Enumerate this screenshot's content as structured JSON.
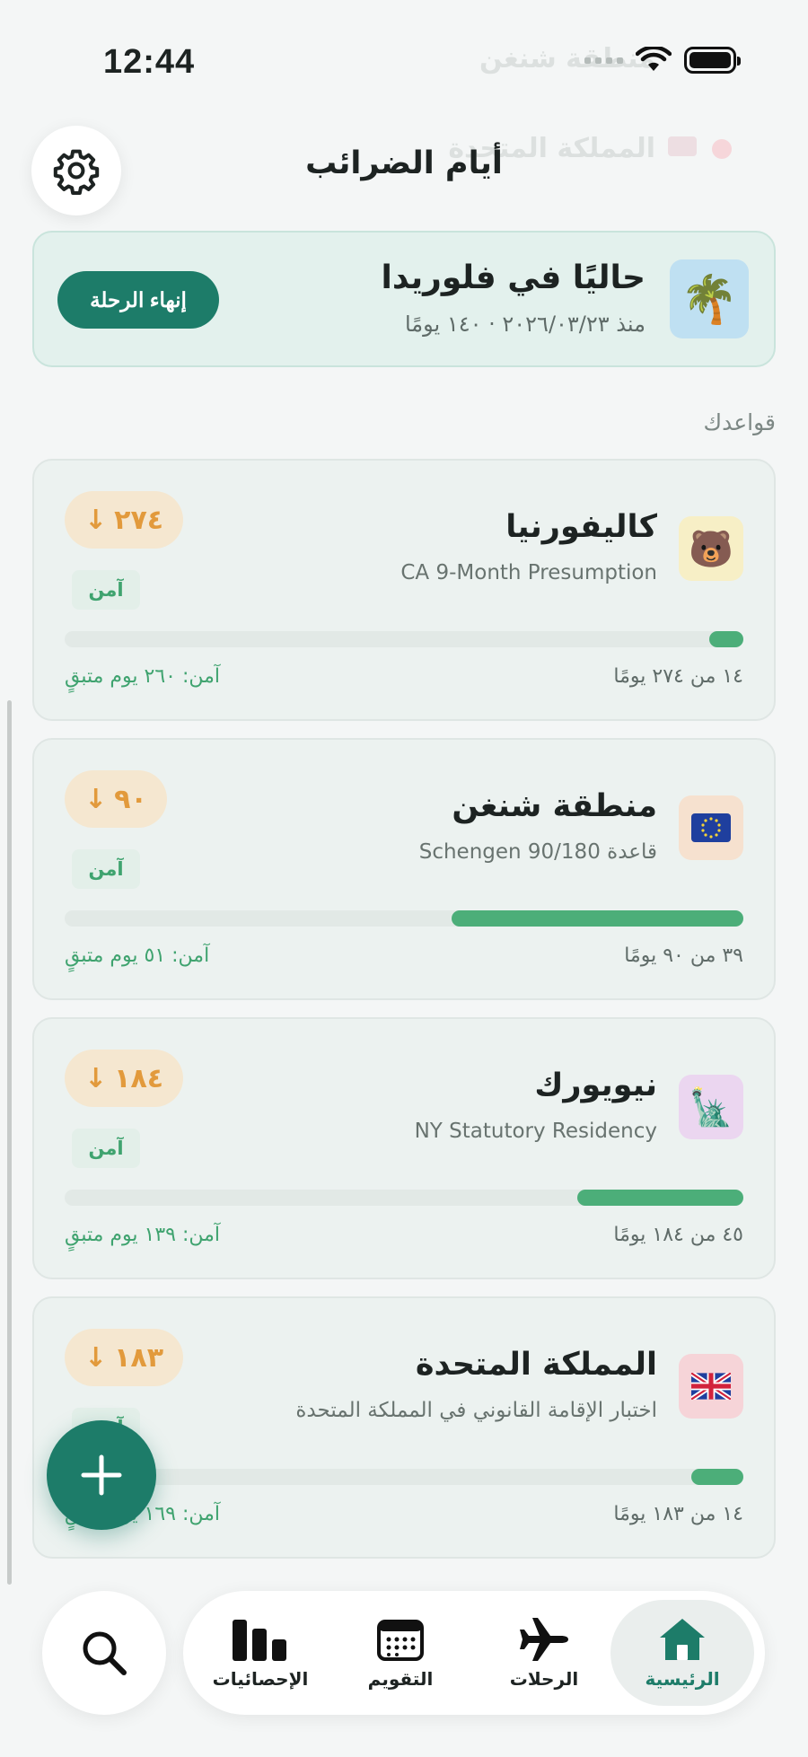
{
  "status_bar": {
    "time": "12:44"
  },
  "ghost": {
    "line1": "منطقة شنغن",
    "line2": "المملكة المتحدة"
  },
  "header": {
    "title": "أيام الضرائب"
  },
  "current_trip": {
    "title": "حاليًا في فلوريدا",
    "subtitle": "منذ ٢٠٢٦/٠٣/٢٣ · ١٤٠ يومًا",
    "icon": "palm-tree-icon",
    "end_button": "إنهاء الرحلة"
  },
  "rules_section": {
    "label": "قواعدك",
    "rules": [
      {
        "name": "كاليفورنيا",
        "subtitle": "CA 9-Month Presumption",
        "icon": "bear-icon",
        "icon_bg": "#f7efc6",
        "badge": "٢٧٤",
        "status": "آمن",
        "used_text": "١٤ من ٢٧٤ يومًا",
        "remaining_text": "آمن: ٢٦٠ يوم متبقٍ",
        "progress": 0.05
      },
      {
        "name": "منطقة شنغن",
        "subtitle": "قاعدة Schengen 90/180",
        "icon": "eu-flag-icon",
        "icon_bg": "#f6e1cf",
        "badge": "٩٠",
        "status": "آمن",
        "used_text": "٣٩ من ٩٠ يومًا",
        "remaining_text": "آمن: ٥١ يوم متبقٍ",
        "progress": 0.43
      },
      {
        "name": "نيويورك",
        "subtitle": "NY Statutory Residency",
        "icon": "statue-of-liberty-icon",
        "icon_bg": "#ebd6f0",
        "badge": "١٨٤",
        "status": "آمن",
        "used_text": "٤٥ من ١٨٤ يومًا",
        "remaining_text": "آمن: ١٣٩ يوم متبقٍ",
        "progress": 0.245
      },
      {
        "name": "المملكة المتحدة",
        "subtitle": "اختبار الإقامة القانوني في المملكة المتحدة",
        "icon": "uk-flag-icon",
        "icon_bg": "#f6d4d8",
        "badge": "١٨٣",
        "status": "آمن",
        "used_text": "١٤ من ١٨٣ يومًا",
        "remaining_text": "آمن: ١٦٩ يوم متبقٍ",
        "progress": 0.077
      }
    ]
  },
  "fab": {
    "icon": "plus-icon"
  },
  "tab_bar": {
    "search_icon": "search-icon",
    "tabs": [
      {
        "label": "الرئيسية",
        "icon": "home-icon",
        "active": true
      },
      {
        "label": "الرحلات",
        "icon": "airplane-icon",
        "active": false
      },
      {
        "label": "التقويم",
        "icon": "calendar-icon",
        "active": false
      },
      {
        "label": "الإحصائيات",
        "icon": "chart-icon",
        "active": false
      }
    ]
  },
  "colors": {
    "accent": "#1d7c69",
    "safe": "#4cae79",
    "warning_badge": "#e29a3c"
  }
}
